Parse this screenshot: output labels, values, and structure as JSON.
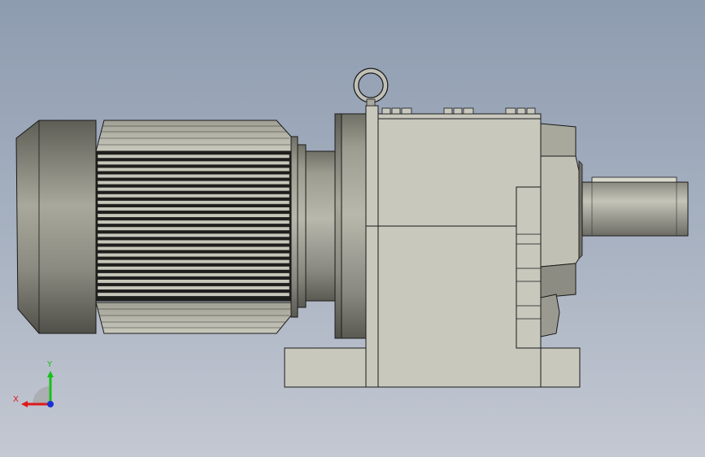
{
  "viewport": {
    "background_top": "#8e9cb0",
    "background_bottom": "#c4c8d2"
  },
  "model": {
    "shade_color": "#c8c8bd",
    "edge_color": "#1a1a1a"
  },
  "triad": {
    "x_label": "X",
    "y_label": "Y",
    "x_color": "#e01818",
    "y_color": "#18c018",
    "z_color": "#1830d8"
  }
}
